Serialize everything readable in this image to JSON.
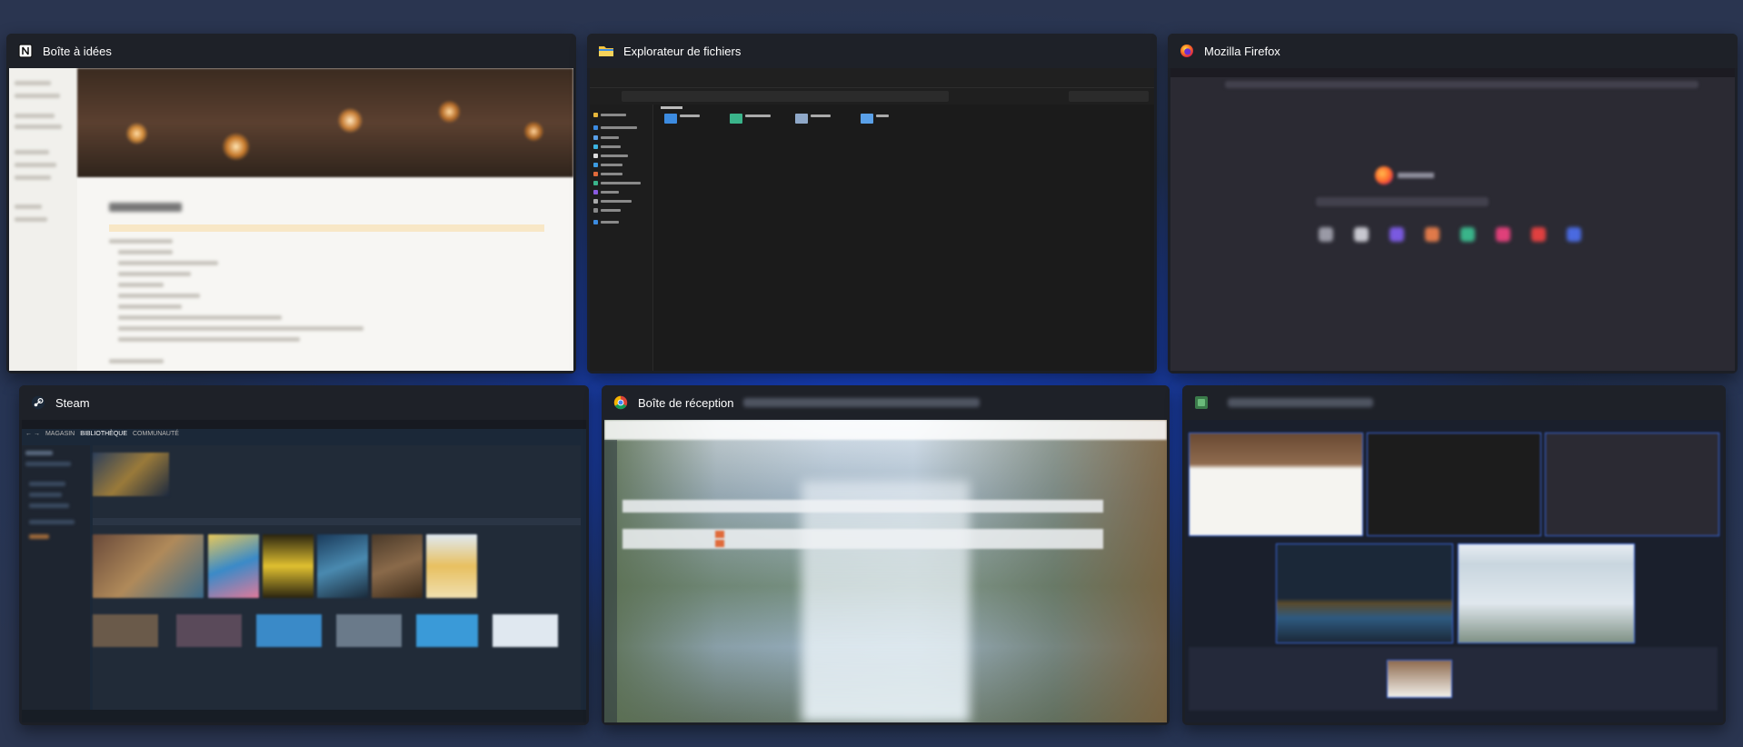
{
  "task_view": {
    "windows": [
      {
        "id": "notion",
        "title": "Boîte à idées",
        "icon": "notion-icon"
      },
      {
        "id": "explorer",
        "title": "Explorateur de fichiers",
        "icon": "folder-icon"
      },
      {
        "id": "firefox",
        "title": "Mozilla Firefox",
        "icon": "firefox-icon"
      },
      {
        "id": "steam",
        "title": "Steam",
        "icon": "steam-icon",
        "nav": [
          "MAGASIN",
          "BIBLIOTHÈQUE",
          "COMMUNAUTÉ"
        ]
      },
      {
        "id": "gmail",
        "title": "Boîte de réception",
        "icon": "chrome-icon"
      },
      {
        "id": "capture",
        "title": "",
        "icon": "app-icon"
      }
    ]
  },
  "colors": {
    "background_glow": "#1747d8",
    "card_header": "#1e2128",
    "title_text": "#ffffff"
  }
}
